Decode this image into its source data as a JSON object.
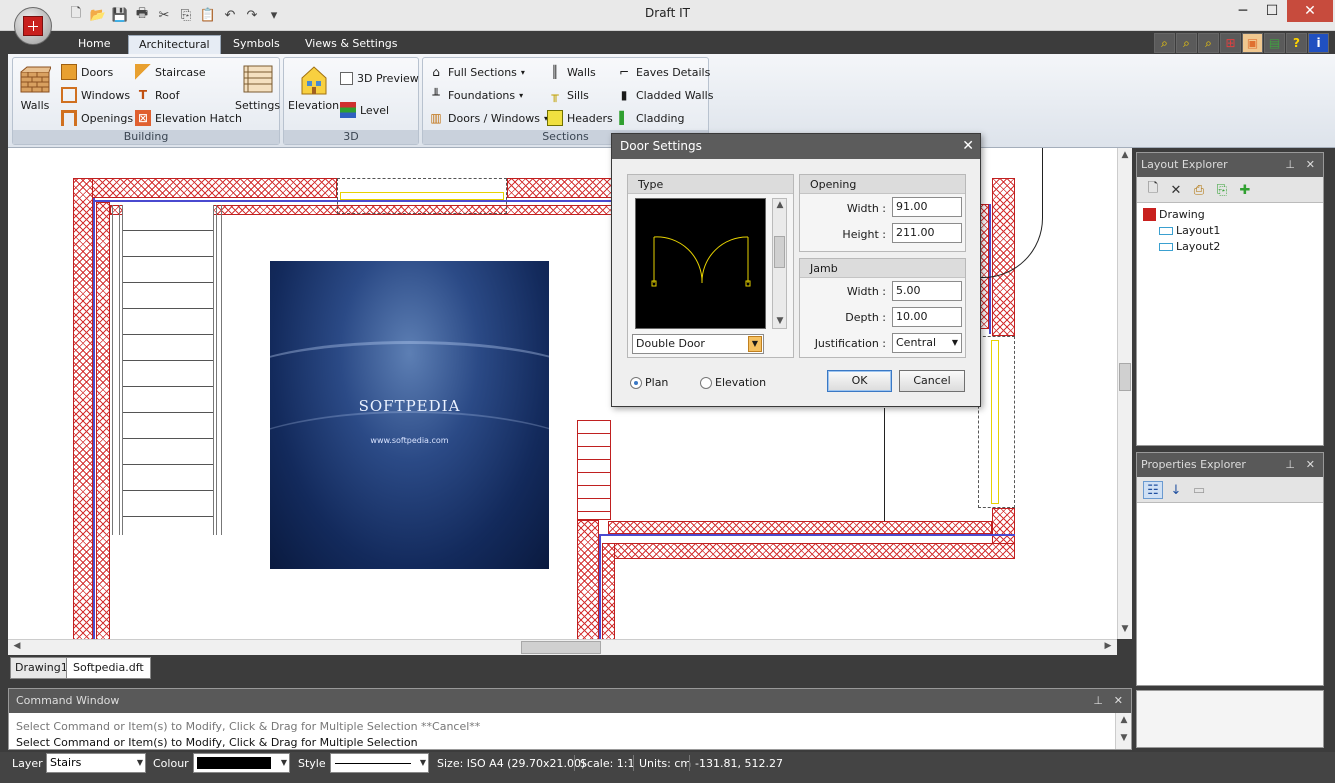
{
  "window": {
    "title": "Draft IT",
    "min": "─",
    "max": "☐",
    "close": "✕"
  },
  "qat": [
    "🗋",
    "📂",
    "💾",
    "🖶",
    "✂",
    "⎘",
    "📋",
    "↶",
    "↷",
    "▾"
  ],
  "tabs": [
    "Home",
    "Architectural",
    "Symbols",
    "Views & Settings"
  ],
  "tab_tools": [
    "⌕",
    "⌕",
    "⌕",
    "⊞",
    "▣",
    "▤",
    "?",
    "i"
  ],
  "groups": {
    "building": {
      "caption": "Building",
      "walls": "Walls",
      "doors": "Doors",
      "windows": "Windows",
      "openings": "Openings",
      "staircase": "Staircase",
      "roof": "Roof",
      "elevation_hatch": "Elevation Hatch",
      "settings": "Settings"
    },
    "three_d": {
      "caption": "3D",
      "elevation": "Elevation",
      "preview": "3D Preview",
      "level": "Level"
    },
    "sections": {
      "caption": "Sections",
      "full_sections": "Full Sections",
      "foundations": "Foundations",
      "doors_windows": "Doors / Windows",
      "walls": "Walls",
      "sills": "Sills",
      "headers": "Headers",
      "eaves_details": "Eaves Details",
      "cladded_walls": "Cladded Walls",
      "cladding": "Cladding"
    }
  },
  "canvas": {
    "image_logo": "SOFTPEDIA",
    "image_url": "www.softpedia.com"
  },
  "doc_tabs": [
    "Drawing1",
    "Softpedia.dft"
  ],
  "command": {
    "title": "Command Window",
    "lines": [
      "Select Command or Item(s) to Modify, Click & Drag for Multiple Selection  **Cancel**",
      "Select Command or Item(s) to Modify, Click & Drag for Multiple Selection"
    ]
  },
  "layout_explorer": {
    "title": "Layout Explorer",
    "root": "Drawing",
    "items": [
      "Layout1",
      "Layout2"
    ]
  },
  "properties_explorer": {
    "title": "Properties Explorer"
  },
  "status": {
    "layer_label": "Layer",
    "layer_value": "Stairs",
    "colour_label": "Colour",
    "colour_value": "#000000",
    "style_label": "Style",
    "size": "Size: ISO A4 (29.70x21.00)",
    "scale": "Scale: 1:1",
    "units": "Units: cm",
    "coords": "-131.81, 512.27"
  },
  "dialog": {
    "title": "Door Settings",
    "type_legend": "Type",
    "type_value": "Double Door",
    "opening_legend": "Opening",
    "width_label": "Width :",
    "width_value": "91.00",
    "height_label": "Height :",
    "height_value": "211.00",
    "jamb_legend": "Jamb",
    "jamb_width_label": "Width :",
    "jamb_width_value": "5.00",
    "depth_label": "Depth :",
    "depth_value": "10.00",
    "justification_label": "Justification :",
    "justification_value": "Central",
    "plan_label": "Plan",
    "elevation_label": "Elevation",
    "ok": "OK",
    "cancel": "Cancel"
  }
}
